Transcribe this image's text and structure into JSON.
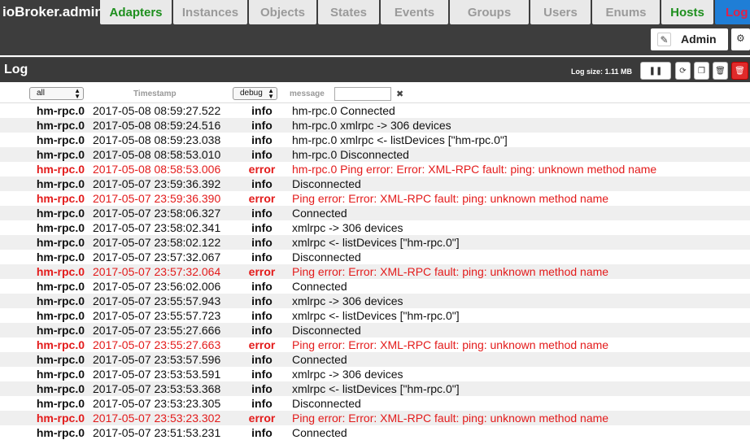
{
  "app": {
    "title": "ioBroker.admin"
  },
  "tabs": [
    {
      "label": "Adapters",
      "state": "green"
    },
    {
      "label": "Instances",
      "state": "normal"
    },
    {
      "label": "Objects",
      "state": "normal"
    },
    {
      "label": "States",
      "state": "normal"
    },
    {
      "label": "Events",
      "state": "normal"
    },
    {
      "label": "Groups",
      "state": "normal"
    },
    {
      "label": "Users",
      "state": "normal"
    },
    {
      "label": "Enums",
      "state": "normal"
    },
    {
      "label": "Hosts",
      "state": "green"
    },
    {
      "label": "Log",
      "state": "active"
    }
  ],
  "user": {
    "name": "Admin",
    "edit_icon": "pencil-icon",
    "settings_icon": "gear-icon"
  },
  "log": {
    "title": "Log",
    "size_label": "Log size: 1.11 MB",
    "controls": [
      {
        "name": "pause-button",
        "icon": "pause-icon",
        "glyph": "❚❚"
      },
      {
        "name": "refresh-button",
        "icon": "refresh-icon",
        "glyph": "⟳"
      },
      {
        "name": "copy-button",
        "icon": "copy-icon",
        "glyph": "❐"
      },
      {
        "name": "clear-button",
        "icon": "trash-icon",
        "glyph": "🗑"
      },
      {
        "name": "delete-log-button",
        "icon": "trash-red-icon",
        "glyph": "🗑"
      }
    ],
    "filters": {
      "source": "all",
      "timestamp_header": "Timestamp",
      "severity": "debug",
      "message_header": "message",
      "message_filter": "",
      "clear_symbol": "✖"
    },
    "error_color": "#e31b1b",
    "rows": [
      {
        "src": "hm-rpc.0",
        "ts": "2017-05-08 08:59:27.522",
        "sev": "info",
        "msg": "hm-rpc.0 Connected"
      },
      {
        "src": "hm-rpc.0",
        "ts": "2017-05-08 08:59:24.516",
        "sev": "info",
        "msg": "hm-rpc.0 xmlrpc -> 306 devices"
      },
      {
        "src": "hm-rpc.0",
        "ts": "2017-05-08 08:59:23.038",
        "sev": "info",
        "msg": "hm-rpc.0 xmlrpc <- listDevices [\"hm-rpc.0\"]"
      },
      {
        "src": "hm-rpc.0",
        "ts": "2017-05-08 08:58:53.010",
        "sev": "info",
        "msg": "hm-rpc.0 Disconnected"
      },
      {
        "src": "hm-rpc.0",
        "ts": "2017-05-08 08:58:53.006",
        "sev": "error",
        "msg": "hm-rpc.0 Ping error: Error: XML-RPC fault: ping: unknown method name"
      },
      {
        "src": "hm-rpc.0",
        "ts": "2017-05-07 23:59:36.392",
        "sev": "info",
        "msg": "Disconnected"
      },
      {
        "src": "hm-rpc.0",
        "ts": "2017-05-07 23:59:36.390",
        "sev": "error",
        "msg": "Ping error: Error: XML-RPC fault: ping: unknown method name"
      },
      {
        "src": "hm-rpc.0",
        "ts": "2017-05-07 23:58:06.327",
        "sev": "info",
        "msg": "Connected"
      },
      {
        "src": "hm-rpc.0",
        "ts": "2017-05-07 23:58:02.341",
        "sev": "info",
        "msg": "xmlrpc -> 306 devices"
      },
      {
        "src": "hm-rpc.0",
        "ts": "2017-05-07 23:58:02.122",
        "sev": "info",
        "msg": "xmlrpc <- listDevices [\"hm-rpc.0\"]"
      },
      {
        "src": "hm-rpc.0",
        "ts": "2017-05-07 23:57:32.067",
        "sev": "info",
        "msg": "Disconnected"
      },
      {
        "src": "hm-rpc.0",
        "ts": "2017-05-07 23:57:32.064",
        "sev": "error",
        "msg": "Ping error: Error: XML-RPC fault: ping: unknown method name"
      },
      {
        "src": "hm-rpc.0",
        "ts": "2017-05-07 23:56:02.006",
        "sev": "info",
        "msg": "Connected"
      },
      {
        "src": "hm-rpc.0",
        "ts": "2017-05-07 23:55:57.943",
        "sev": "info",
        "msg": "xmlrpc -> 306 devices"
      },
      {
        "src": "hm-rpc.0",
        "ts": "2017-05-07 23:55:57.723",
        "sev": "info",
        "msg": "xmlrpc <- listDevices [\"hm-rpc.0\"]"
      },
      {
        "src": "hm-rpc.0",
        "ts": "2017-05-07 23:55:27.666",
        "sev": "info",
        "msg": "Disconnected"
      },
      {
        "src": "hm-rpc.0",
        "ts": "2017-05-07 23:55:27.663",
        "sev": "error",
        "msg": "Ping error: Error: XML-RPC fault: ping: unknown method name"
      },
      {
        "src": "hm-rpc.0",
        "ts": "2017-05-07 23:53:57.596",
        "sev": "info",
        "msg": "Connected"
      },
      {
        "src": "hm-rpc.0",
        "ts": "2017-05-07 23:53:53.591",
        "sev": "info",
        "msg": "xmlrpc -> 306 devices"
      },
      {
        "src": "hm-rpc.0",
        "ts": "2017-05-07 23:53:53.368",
        "sev": "info",
        "msg": "xmlrpc <- listDevices [\"hm-rpc.0\"]"
      },
      {
        "src": "hm-rpc.0",
        "ts": "2017-05-07 23:53:23.305",
        "sev": "info",
        "msg": "Disconnected"
      },
      {
        "src": "hm-rpc.0",
        "ts": "2017-05-07 23:53:23.302",
        "sev": "error",
        "msg": "Ping error: Error: XML-RPC fault: ping: unknown method name"
      },
      {
        "src": "hm-rpc.0",
        "ts": "2017-05-07 23:51:53.231",
        "sev": "info",
        "msg": "Connected"
      }
    ]
  }
}
